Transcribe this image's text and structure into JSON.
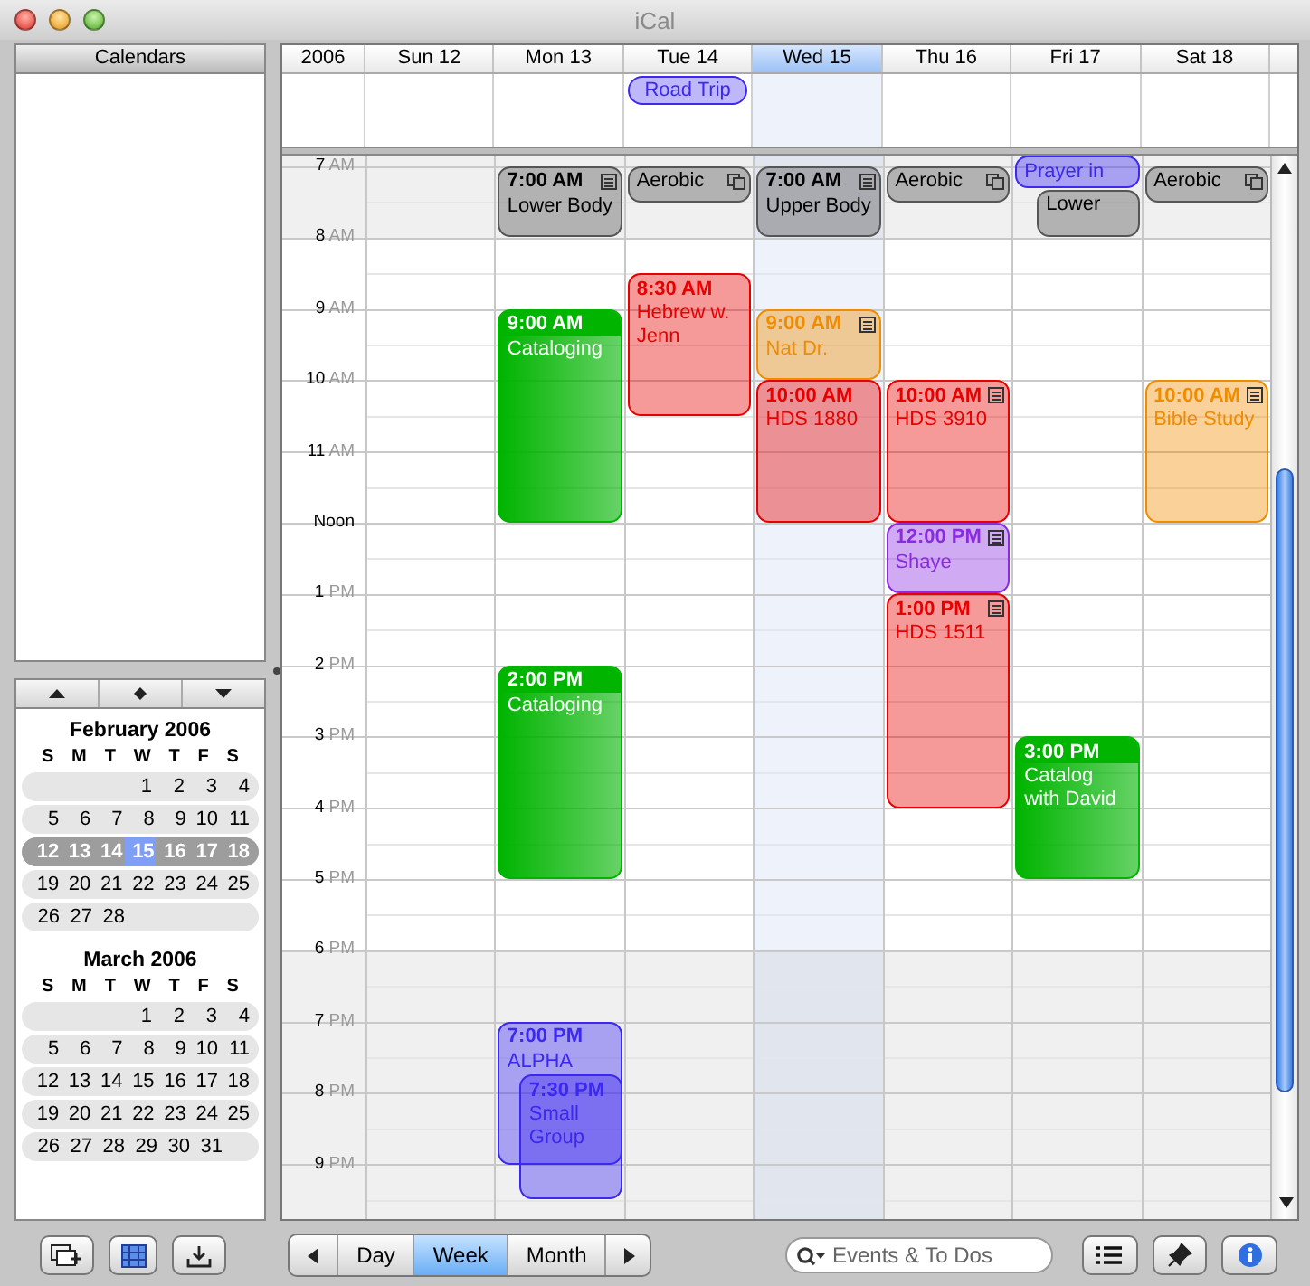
{
  "window": {
    "title": "iCal"
  },
  "sidebar": {
    "calendars_header": "Calendars",
    "mini_calendars": [
      {
        "title": "February 2006",
        "weekdays": [
          "S",
          "M",
          "T",
          "W",
          "T",
          "F",
          "S"
        ],
        "weeks": [
          {
            "kind": "lead",
            "selected": false,
            "days": [
              {
                "n": "1",
                "today": false
              },
              {
                "n": "2",
                "today": false
              },
              {
                "n": "3",
                "today": false
              },
              {
                "n": "4",
                "today": false
              }
            ]
          },
          {
            "kind": "full",
            "selected": false,
            "days": [
              {
                "n": "5",
                "today": false
              },
              {
                "n": "6",
                "today": false
              },
              {
                "n": "7",
                "today": false
              },
              {
                "n": "8",
                "today": false
              },
              {
                "n": "9",
                "today": false
              },
              {
                "n": "10",
                "today": false
              },
              {
                "n": "11",
                "today": false
              }
            ]
          },
          {
            "kind": "full",
            "selected": true,
            "days": [
              {
                "n": "12",
                "today": false
              },
              {
                "n": "13",
                "today": false
              },
              {
                "n": "14",
                "today": false
              },
              {
                "n": "15",
                "today": true
              },
              {
                "n": "16",
                "today": false
              },
              {
                "n": "17",
                "today": false
              },
              {
                "n": "18",
                "today": false
              }
            ]
          },
          {
            "kind": "full",
            "selected": false,
            "days": [
              {
                "n": "19",
                "today": false
              },
              {
                "n": "20",
                "today": false
              },
              {
                "n": "21",
                "today": false
              },
              {
                "n": "22",
                "today": false
              },
              {
                "n": "23",
                "today": false
              },
              {
                "n": "24",
                "today": false
              },
              {
                "n": "25",
                "today": false
              }
            ]
          },
          {
            "kind": "tail",
            "selected": false,
            "days": [
              {
                "n": "26",
                "today": false
              },
              {
                "n": "27",
                "today": false
              },
              {
                "n": "28",
                "today": false
              }
            ]
          }
        ]
      },
      {
        "title": "March 2006",
        "weekdays": [
          "S",
          "M",
          "T",
          "W",
          "T",
          "F",
          "S"
        ],
        "weeks": [
          {
            "kind": "lead",
            "selected": false,
            "days": [
              {
                "n": "1",
                "today": false
              },
              {
                "n": "2",
                "today": false
              },
              {
                "n": "3",
                "today": false
              },
              {
                "n": "4",
                "today": false
              }
            ]
          },
          {
            "kind": "full",
            "selected": false,
            "days": [
              {
                "n": "5",
                "today": false
              },
              {
                "n": "6",
                "today": false
              },
              {
                "n": "7",
                "today": false
              },
              {
                "n": "8",
                "today": false
              },
              {
                "n": "9",
                "today": false
              },
              {
                "n": "10",
                "today": false
              },
              {
                "n": "11",
                "today": false
              }
            ]
          },
          {
            "kind": "full",
            "selected": false,
            "days": [
              {
                "n": "12",
                "today": false
              },
              {
                "n": "13",
                "today": false
              },
              {
                "n": "14",
                "today": false
              },
              {
                "n": "15",
                "today": false
              },
              {
                "n": "16",
                "today": false
              },
              {
                "n": "17",
                "today": false
              },
              {
                "n": "18",
                "today": false
              }
            ]
          },
          {
            "kind": "full",
            "selected": false,
            "days": [
              {
                "n": "19",
                "today": false
              },
              {
                "n": "20",
                "today": false
              },
              {
                "n": "21",
                "today": false
              },
              {
                "n": "22",
                "today": false
              },
              {
                "n": "23",
                "today": false
              },
              {
                "n": "24",
                "today": false
              },
              {
                "n": "25",
                "today": false
              }
            ]
          },
          {
            "kind": "tail",
            "selected": false,
            "days": [
              {
                "n": "26",
                "today": false
              },
              {
                "n": "27",
                "today": false
              },
              {
                "n": "28",
                "today": false
              },
              {
                "n": "29",
                "today": false
              },
              {
                "n": "30",
                "today": false
              },
              {
                "n": "31",
                "today": false
              }
            ]
          }
        ]
      }
    ]
  },
  "week": {
    "year": "2006",
    "hours": [
      {
        "hour": "7",
        "period": "AM"
      },
      {
        "hour": "8",
        "period": "AM"
      },
      {
        "hour": "9",
        "period": "AM"
      },
      {
        "hour": "10",
        "period": "AM"
      },
      {
        "hour": "11",
        "period": "AM"
      },
      {
        "hour": "Noon"
      },
      {
        "hour": "1",
        "period": "PM"
      },
      {
        "hour": "2",
        "period": "PM"
      },
      {
        "hour": "3",
        "period": "PM"
      },
      {
        "hour": "4",
        "period": "PM"
      },
      {
        "hour": "5",
        "period": "PM"
      },
      {
        "hour": "6",
        "period": "PM"
      },
      {
        "hour": "7",
        "period": "PM"
      },
      {
        "hour": "8",
        "period": "PM"
      },
      {
        "hour": "9",
        "period": "PM"
      }
    ],
    "days": [
      {
        "label": "Sun 12",
        "selected": false
      },
      {
        "label": "Mon 13",
        "selected": false,
        "events": [
          {
            "time": "7:00 AM",
            "title": "Lower Body",
            "color": "#555555",
            "selected": false
          },
          {
            "time": "9:00 AM",
            "title": "Cataloging",
            "color": "#00b400",
            "selected": true
          },
          {
            "time": "2:00 PM",
            "title": "Cataloging",
            "color": "#00b400",
            "selected": true
          },
          {
            "time": "7:00 PM",
            "title": "ALPHA",
            "color": "#3c28f0",
            "selected": false
          },
          {
            "time": "7:30 PM",
            "title": "Small Group",
            "color": "#3c28f0",
            "selected": false
          }
        ]
      },
      {
        "label": "Tue 14",
        "selected": false,
        "all_day": [
          {
            "title": "Road Trip",
            "color": "#3c28f0"
          }
        ],
        "events": [
          {
            "title": "Aerobic",
            "color": "#555555",
            "selected": false
          },
          {
            "time": "8:30 AM",
            "title": "Hebrew w. Jenn",
            "color": "#e80000",
            "selected": false
          }
        ]
      },
      {
        "label": "Wed 15",
        "selected": true,
        "events": [
          {
            "time": "7:00 AM",
            "title": "Upper Body",
            "color": "#555555",
            "selected": false
          },
          {
            "time": "9:00 AM",
            "title": "Nat Dr.",
            "color": "#f08c00",
            "selected": false
          },
          {
            "time": "10:00 AM",
            "title": "HDS 1880",
            "color": "#e80000",
            "selected": false
          }
        ]
      },
      {
        "label": "Thu 16",
        "selected": false,
        "events": [
          {
            "title": "Aerobic",
            "color": "#555555",
            "selected": false
          },
          {
            "time": "10:00 AM",
            "title": "HDS 3910",
            "color": "#e80000",
            "selected": false
          },
          {
            "time": "12:00 PM",
            "title": "Shaye",
            "color": "#8a2be2",
            "selected": false
          },
          {
            "time": "1:00 PM",
            "title": "HDS 1511",
            "color": "#e80000",
            "selected": false
          }
        ]
      },
      {
        "label": "Fri 17",
        "selected": false,
        "events": [
          {
            "title": "Prayer in",
            "color": "#3c28f0",
            "selected": false
          },
          {
            "title": "Lower",
            "color": "#555555",
            "selected": false
          },
          {
            "time": "3:00 PM",
            "title": "Catalog with David",
            "color": "#00b400",
            "selected": true
          }
        ]
      },
      {
        "label": "Sat 18",
        "selected": false,
        "events": [
          {
            "title": "Aerobic",
            "color": "#555555",
            "selected": false
          },
          {
            "time": "10:00 AM",
            "title": "Bible Study",
            "color": "#f08c00",
            "selected": false
          }
        ]
      }
    ]
  },
  "toolbar": {
    "views": [
      {
        "label": "Day",
        "selected": false
      },
      {
        "label": "Week",
        "selected": true
      },
      {
        "label": "Month",
        "selected": false
      }
    ],
    "search": {
      "placeholder": "Events & To Dos"
    }
  }
}
